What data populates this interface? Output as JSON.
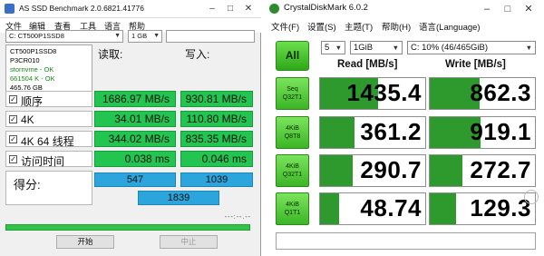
{
  "asssd": {
    "title": "AS SSD Benchmark 2.0.6821.41776",
    "menus": [
      "文件",
      "编辑",
      "查看",
      "工具",
      "语言",
      "帮助"
    ],
    "drive_select": "C: CT500P1SSD8",
    "size_select": "1 GB",
    "drive_info": {
      "model": "CT500P1SSD8",
      "firmware": "P3CR010",
      "driver": "stornvme - OK",
      "alignment": "661504 K - OK",
      "capacity": "465.76 GB"
    },
    "read_header": "读取:",
    "write_header": "写入:",
    "rows": [
      {
        "label": "顺序",
        "read": "1686.97 MB/s",
        "write": "930.81 MB/s"
      },
      {
        "label": "4K",
        "read": "34.01 MB/s",
        "write": "110.80 MB/s"
      },
      {
        "label": "4K 64 线程",
        "read": "344.02 MB/s",
        "write": "835.35 MB/s"
      },
      {
        "label": "访问时间",
        "read": "0.038 ms",
        "write": "0.046 ms"
      }
    ],
    "score_label": "得分:",
    "score_read": "547",
    "score_write": "1039",
    "score_total": "1839",
    "progress_text": "---:--.--",
    "progress_fraction": 1,
    "start_button": "开始",
    "stop_button": "中止"
  },
  "cdm": {
    "title": "CrystalDiskMark 6.0.2",
    "menus": [
      "文件(F)",
      "设置(S)",
      "主题(T)",
      "帮助(H)",
      "语言(Language)"
    ],
    "all_button": "All",
    "runs": "5",
    "test_size": "1GiB",
    "drive": "C: 10% (46/465GiB)",
    "read_header": "Read [MB/s]",
    "write_header": "Write [MB/s]",
    "rows": [
      {
        "label1": "Seq",
        "label2": "Q32T1",
        "read": "1435.4",
        "write": "862.3",
        "read_fill": 0.55,
        "write_fill": 0.47
      },
      {
        "label1": "4KiB",
        "label2": "Q8T8",
        "read": "361.2",
        "write": "919.1",
        "read_fill": 0.33,
        "write_fill": 0.48
      },
      {
        "label1": "4KiB",
        "label2": "Q32T1",
        "read": "290.7",
        "write": "272.7",
        "read_fill": 0.31,
        "write_fill": 0.31
      },
      {
        "label1": "4KiB",
        "label2": "Q1T1",
        "read": "48.74",
        "write": "129.3",
        "read_fill": 0.18,
        "write_fill": 0.25
      }
    ],
    "colors": {
      "bar": "#2e9a2e",
      "button": "#3bb526"
    }
  }
}
